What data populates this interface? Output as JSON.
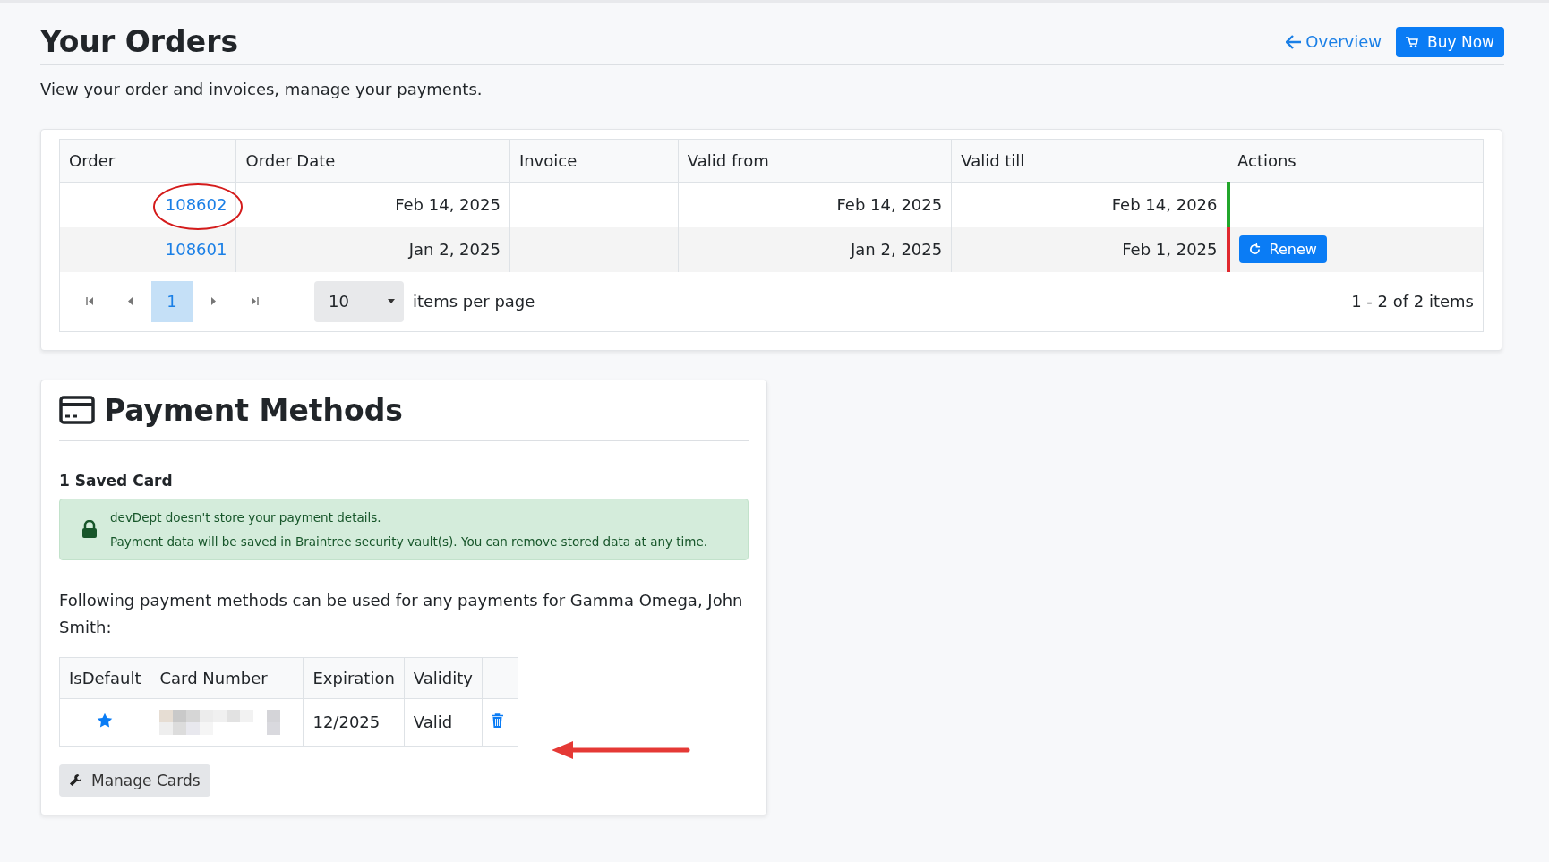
{
  "header": {
    "title": "Your Orders",
    "overview_link": "Overview",
    "buy_button": "Buy Now",
    "subtitle": "View your order and invoices, manage your payments."
  },
  "orders": {
    "columns": [
      "Order",
      "Order Date",
      "Invoice",
      "Valid from",
      "Valid till",
      "Actions"
    ],
    "rows": [
      {
        "order": "108602",
        "order_date": "Feb 14, 2025",
        "invoice": "",
        "valid_from": "Feb 14, 2025",
        "valid_till": "Feb 14, 2026",
        "color": "#22a62b",
        "action": "",
        "circled": true
      },
      {
        "order": "108601",
        "order_date": "Jan 2, 2025",
        "invoice": "",
        "valid_from": "Jan 2, 2025",
        "valid_till": "Feb 1, 2025",
        "color": "#e0282e",
        "action": "Renew",
        "circled": false
      }
    ],
    "pager": {
      "pages": [
        {
          "label": "1",
          "selected": true
        }
      ],
      "page_size": "10",
      "page_size_label": "items per page",
      "summary": "1 - 2 of 2 items"
    }
  },
  "payment": {
    "title": "Payment Methods",
    "saved_count": "1 Saved Card",
    "notice": [
      "devDept doesn't store your payment details.",
      "Payment data will be saved in Braintree security vault(s). You can remove stored data at any time."
    ],
    "description": "Following payment methods can be used for any payments for Gamma Omega, John Smith:",
    "columns": [
      "IsDefault",
      "Card Number",
      "Expiration",
      "Validity",
      ""
    ],
    "cards": [
      {
        "is_default": true,
        "expiration": "12/2025",
        "validity": "Valid",
        "arrow": true
      }
    ],
    "manage_button": "Manage Cards"
  }
}
